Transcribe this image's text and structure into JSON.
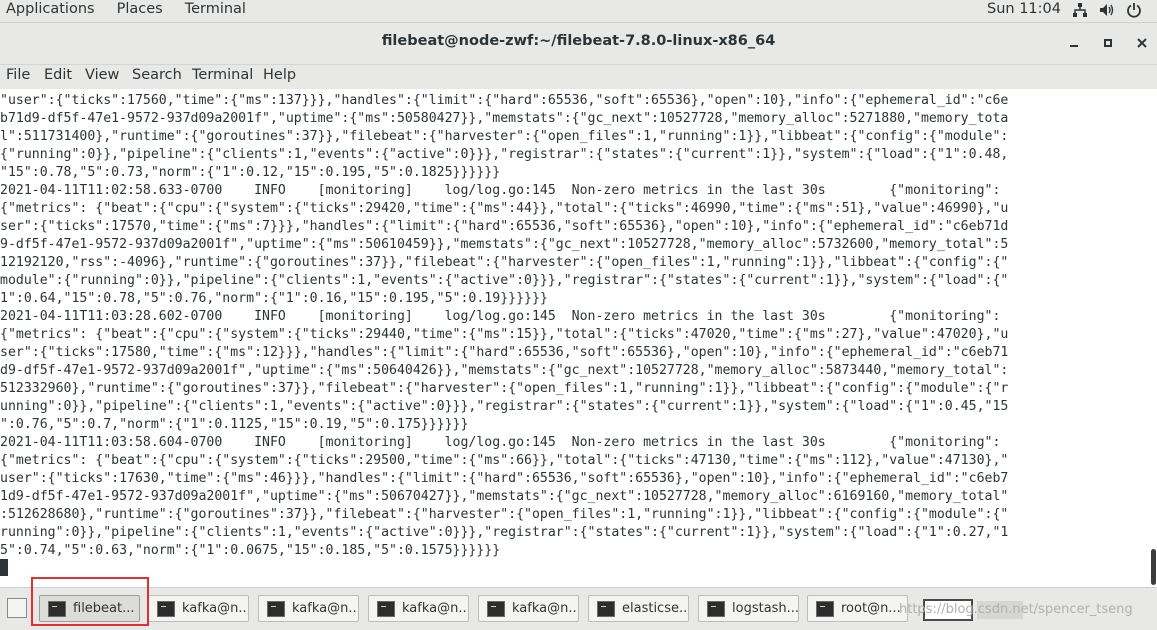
{
  "topbar": {
    "menus": [
      "Applications",
      "Places",
      "Terminal"
    ],
    "clock": "Sun 11:04",
    "tray_icons": [
      "network-icon",
      "volume-icon",
      "power-icon"
    ]
  },
  "window": {
    "title": "filebeat@node-zwf:~/filebeat-7.8.0-linux-x86_64",
    "controls": [
      "minimize-icon",
      "maximize-icon",
      "close-icon"
    ]
  },
  "menubar": [
    "File",
    "Edit",
    "View",
    "Search",
    "Terminal",
    "Help"
  ],
  "terminal": {
    "lines": [
      "\"user\":{\"ticks\":17560,\"time\":{\"ms\":137}}},\"handles\":{\"limit\":{\"hard\":65536,\"soft\":65536},\"open\":10},\"info\":{\"ephemeral_id\":\"c6e",
      "b71d9-df5f-47e1-9572-937d09a2001f\",\"uptime\":{\"ms\":50580427}},\"memstats\":{\"gc_next\":10527728,\"memory_alloc\":5271880,\"memory_tota",
      "l\":511731400},\"runtime\":{\"goroutines\":37}},\"filebeat\":{\"harvester\":{\"open_files\":1,\"running\":1}},\"libbeat\":{\"config\":{\"module\":",
      "{\"running\":0}},\"pipeline\":{\"clients\":1,\"events\":{\"active\":0}}},\"registrar\":{\"states\":{\"current\":1}},\"system\":{\"load\":{\"1\":0.48,",
      "\"15\":0.78,\"5\":0.73,\"norm\":{\"1\":0.12,\"15\":0.195,\"5\":0.1825}}}}}}",
      "2021-04-11T11:02:58.633-0700    INFO    [monitoring]    log/log.go:145  Non-zero metrics in the last 30s        {\"monitoring\":",
      "{\"metrics\": {\"beat\":{\"cpu\":{\"system\":{\"ticks\":29420,\"time\":{\"ms\":44}},\"total\":{\"ticks\":46990,\"time\":{\"ms\":51},\"value\":46990},\"u",
      "ser\":{\"ticks\":17570,\"time\":{\"ms\":7}}},\"handles\":{\"limit\":{\"hard\":65536,\"soft\":65536},\"open\":10},\"info\":{\"ephemeral_id\":\"c6eb71d",
      "9-df5f-47e1-9572-937d09a2001f\",\"uptime\":{\"ms\":50610459}},\"memstats\":{\"gc_next\":10527728,\"memory_alloc\":5732600,\"memory_total\":5",
      "12192120,\"rss\":-4096},\"runtime\":{\"goroutines\":37}},\"filebeat\":{\"harvester\":{\"open_files\":1,\"running\":1}},\"libbeat\":{\"config\":{\"",
      "module\":{\"running\":0}},\"pipeline\":{\"clients\":1,\"events\":{\"active\":0}}},\"registrar\":{\"states\":{\"current\":1}},\"system\":{\"load\":{\"",
      "1\":0.64,\"15\":0.78,\"5\":0.76,\"norm\":{\"1\":0.16,\"15\":0.195,\"5\":0.19}}}}}}",
      "2021-04-11T11:03:28.602-0700    INFO    [monitoring]    log/log.go:145  Non-zero metrics in the last 30s        {\"monitoring\":",
      "{\"metrics\": {\"beat\":{\"cpu\":{\"system\":{\"ticks\":29440,\"time\":{\"ms\":15}},\"total\":{\"ticks\":47020,\"time\":{\"ms\":27},\"value\":47020},\"u",
      "ser\":{\"ticks\":17580,\"time\":{\"ms\":12}}},\"handles\":{\"limit\":{\"hard\":65536,\"soft\":65536},\"open\":10},\"info\":{\"ephemeral_id\":\"c6eb71",
      "d9-df5f-47e1-9572-937d09a2001f\",\"uptime\":{\"ms\":50640426}},\"memstats\":{\"gc_next\":10527728,\"memory_alloc\":5873440,\"memory_total\":",
      "512332960},\"runtime\":{\"goroutines\":37}},\"filebeat\":{\"harvester\":{\"open_files\":1,\"running\":1}},\"libbeat\":{\"config\":{\"module\":{\"r",
      "unning\":0}},\"pipeline\":{\"clients\":1,\"events\":{\"active\":0}}},\"registrar\":{\"states\":{\"current\":1}},\"system\":{\"load\":{\"1\":0.45,\"15",
      "\":0.76,\"5\":0.7,\"norm\":{\"1\":0.1125,\"15\":0.19,\"5\":0.175}}}}}}",
      "2021-04-11T11:03:58.604-0700    INFO    [monitoring]    log/log.go:145  Non-zero metrics in the last 30s        {\"monitoring\":",
      "{\"metrics\": {\"beat\":{\"cpu\":{\"system\":{\"ticks\":29500,\"time\":{\"ms\":66}},\"total\":{\"ticks\":47130,\"time\":{\"ms\":112},\"value\":47130},\"",
      "user\":{\"ticks\":17630,\"time\":{\"ms\":46}}},\"handles\":{\"limit\":{\"hard\":65536,\"soft\":65536},\"open\":10},\"info\":{\"ephemeral_id\":\"c6eb7",
      "1d9-df5f-47e1-9572-937d09a2001f\",\"uptime\":{\"ms\":50670427}},\"memstats\":{\"gc_next\":10527728,\"memory_alloc\":6169160,\"memory_total\"",
      ":512628680},\"runtime\":{\"goroutines\":37}},\"filebeat\":{\"harvester\":{\"open_files\":1,\"running\":1}},\"libbeat\":{\"config\":{\"module\":{\"",
      "running\":0}},\"pipeline\":{\"clients\":1,\"events\":{\"active\":0}}},\"registrar\":{\"states\":{\"current\":1}},\"system\":{\"load\":{\"1\":0.27,\"1",
      "5\":0.74,\"5\":0.63,\"norm\":{\"1\":0.0675,\"15\":0.185,\"5\":0.1575}}}}}}"
    ]
  },
  "taskbar": {
    "tasks": [
      {
        "label": "filebeat...",
        "active": true
      },
      {
        "label": "kafka@n...",
        "active": false
      },
      {
        "label": "kafka@n...",
        "active": false
      },
      {
        "label": "kafka@n...",
        "active": false
      },
      {
        "label": "kafka@n...",
        "active": false
      },
      {
        "label": "elasticse...",
        "active": false
      },
      {
        "label": "logstash...",
        "active": false
      },
      {
        "label": "root@n...",
        "active": false
      }
    ],
    "watermark": "https://blog.csdn.net/spencer_tseng",
    "highlight_color": "#e03030"
  }
}
